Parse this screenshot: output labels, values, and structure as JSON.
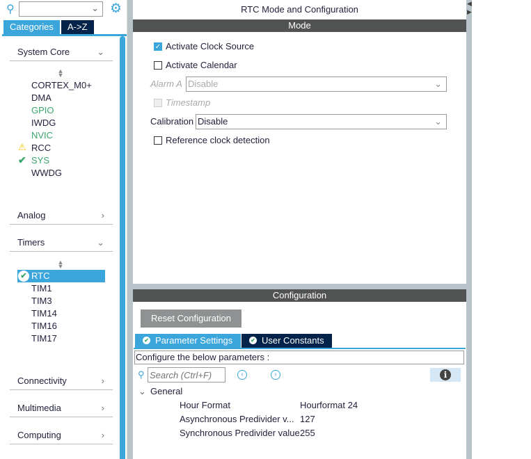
{
  "sidebar": {
    "search_value": "",
    "tabs": [
      "Categories",
      "A->Z"
    ],
    "sections": [
      {
        "label": "System Core",
        "expanded": true,
        "items": [
          {
            "label": "CORTEX_M0+",
            "status": "none"
          },
          {
            "label": "DMA",
            "status": "none"
          },
          {
            "label": "GPIO",
            "status": "configured"
          },
          {
            "label": "IWDG",
            "status": "none"
          },
          {
            "label": "NVIC",
            "status": "configured"
          },
          {
            "label": "RCC",
            "status": "warning"
          },
          {
            "label": "SYS",
            "status": "ok"
          },
          {
            "label": "WWDG",
            "status": "none"
          }
        ]
      },
      {
        "label": "Analog",
        "expanded": false
      },
      {
        "label": "Timers",
        "expanded": true,
        "items": [
          {
            "label": "RTC",
            "status": "ok-selected"
          },
          {
            "label": "TIM1"
          },
          {
            "label": "TIM3"
          },
          {
            "label": "TIM14"
          },
          {
            "label": "TIM16"
          },
          {
            "label": "TIM17"
          }
        ]
      },
      {
        "label": "Connectivity",
        "expanded": false
      },
      {
        "label": "Multimedia",
        "expanded": false
      },
      {
        "label": "Computing",
        "expanded": false
      }
    ]
  },
  "main": {
    "title": "RTC Mode and Configuration",
    "mode": {
      "header": "Mode",
      "activate_clock_source": {
        "label": "Activate Clock Source",
        "checked": true
      },
      "activate_calendar": {
        "label": "Activate Calendar",
        "checked": false
      },
      "alarm_a": {
        "label": "Alarm A",
        "value": "Disable"
      },
      "timestamp": {
        "label": "Timestamp",
        "checked": false
      },
      "calibration": {
        "label": "Calibration",
        "value": "Disable"
      },
      "reference_clock": {
        "label": "Reference clock detection",
        "checked": false
      }
    },
    "config": {
      "header": "Configuration",
      "reset_label": "Reset Configuration",
      "tabs": [
        "Parameter Settings",
        "User Constants"
      ],
      "hint": "Configure the below parameters :",
      "search_placeholder": "Search (Ctrl+F)",
      "group": "General",
      "params": [
        {
          "name": "Hour Format",
          "value": "Hourformat 24"
        },
        {
          "name": "Asynchronous Predivider v...",
          "value": "127"
        },
        {
          "name": "Synchronous Predivider value",
          "value": "255"
        }
      ]
    }
  },
  "colors": {
    "accent": "#3ba6dc",
    "dark_tab": "#03234b",
    "header": "#505352",
    "ok": "#3aa56a",
    "warning": "#f5c400"
  }
}
